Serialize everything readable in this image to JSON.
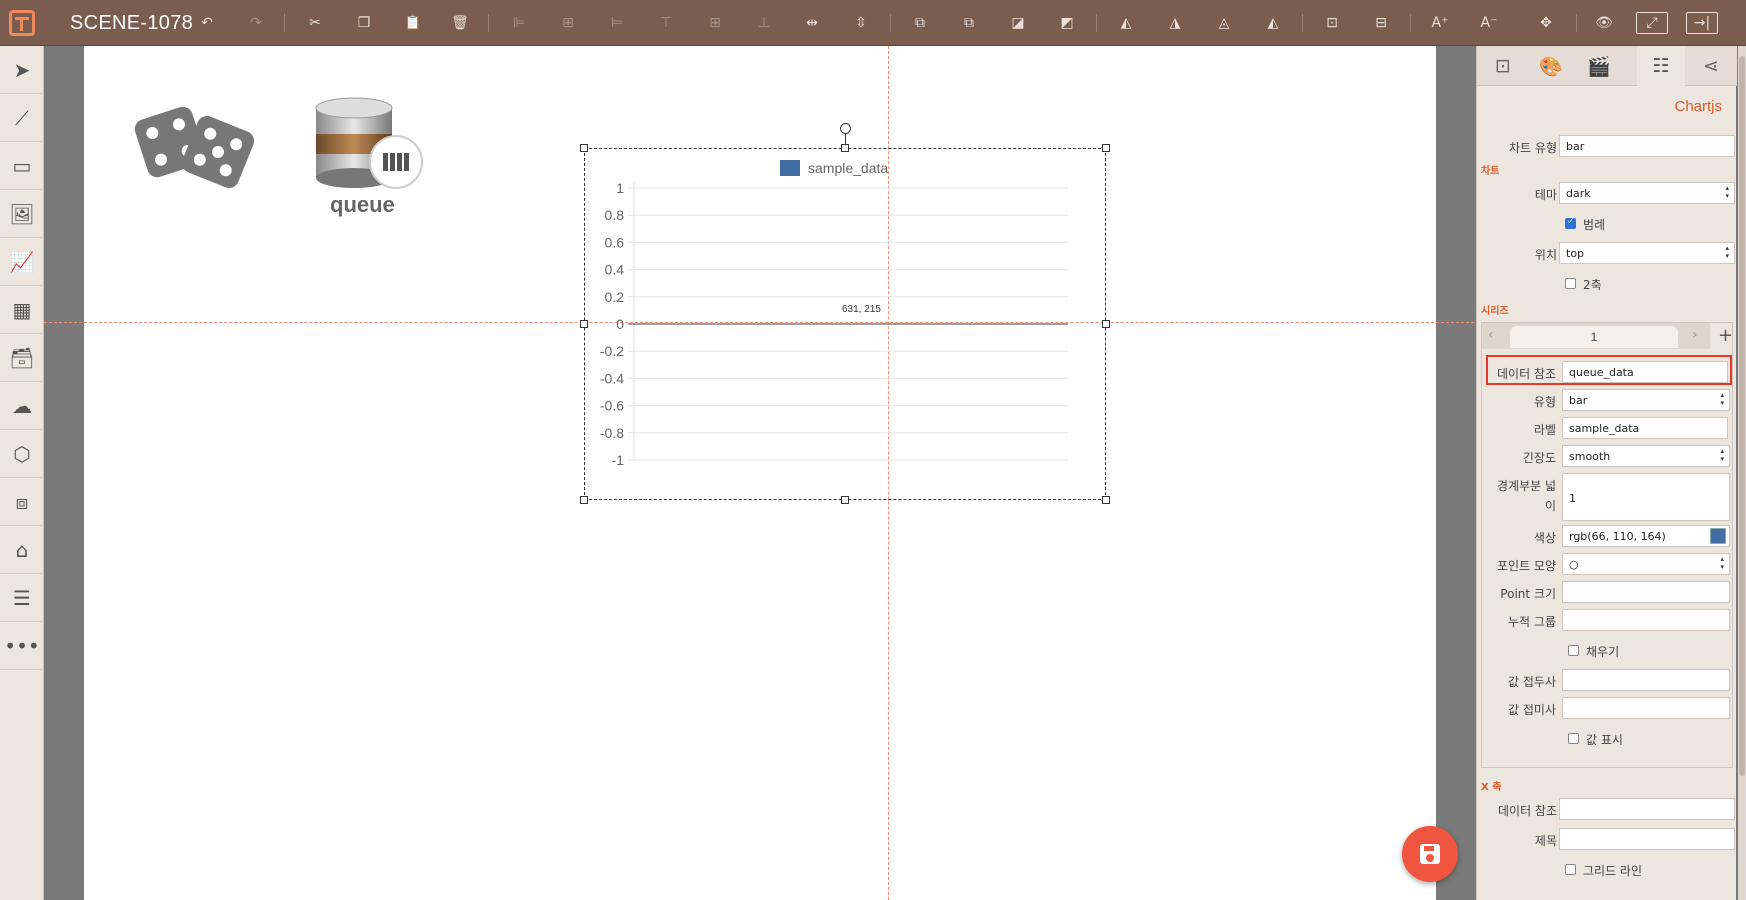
{
  "app": {
    "scene_title": "SCENE-1078"
  },
  "canvas": {
    "queue_label": "queue",
    "coord_readout": "631, 215"
  },
  "chart_data": {
    "type": "bar",
    "legend": [
      "sample_data"
    ],
    "legend_placement": "top",
    "ylim": [
      -1,
      1
    ],
    "yticks": [
      "1",
      "0.8",
      "0.6",
      "0.4",
      "0.2",
      "0",
      "-0.2",
      "-0.4",
      "-0.6",
      "-0.8",
      "-1"
    ],
    "series": [
      {
        "name": "sample_data",
        "values": []
      }
    ],
    "grid": true,
    "series_color": "#426ea4"
  },
  "panel": {
    "title": "Chartjs",
    "chart_type_label": "차트 유형",
    "chart_type_value": "bar",
    "section_chart": "차트",
    "theme_label": "테마",
    "theme_value": "dark",
    "legend_label": "범례",
    "legend_checked": true,
    "position_label": "위치",
    "position_value": "top",
    "dual_axis_label": "2축",
    "dual_axis_checked": false,
    "section_series": "시리즈",
    "series_tab": "1",
    "data_ref_label": "데이터 참조",
    "data_ref_value": "queue_data",
    "type_label": "유형",
    "type_value": "bar",
    "label_label": "라벨",
    "label_value": "sample_data",
    "tension_label": "긴장도",
    "tension_value": "smooth",
    "border_width_label_1": "경계부분 넓",
    "border_width_label_2": "이",
    "border_width_value": "1",
    "color_label": "색상",
    "color_value": "rgb(66, 110, 164)",
    "color_hex": "#426ea4",
    "point_shape_label": "포인트 모양",
    "point_shape_value": "○",
    "point_size_label": "Point 크기",
    "stack_group_label": "누적 그룹",
    "fill_label": "채우기",
    "prefix_label": "값 접두사",
    "suffix_label": "값 접미사",
    "show_value_label": "값 표시",
    "section_xaxis": "X 축",
    "x_data_ref_label": "데이터 참조",
    "x_title_label": "제목",
    "gridline_label": "그리드 라인"
  },
  "colors": {
    "accent": "#e35a2a",
    "toolbar": "#7b5d50",
    "fab": "#f0553f",
    "highlight": "#e53a2a"
  }
}
